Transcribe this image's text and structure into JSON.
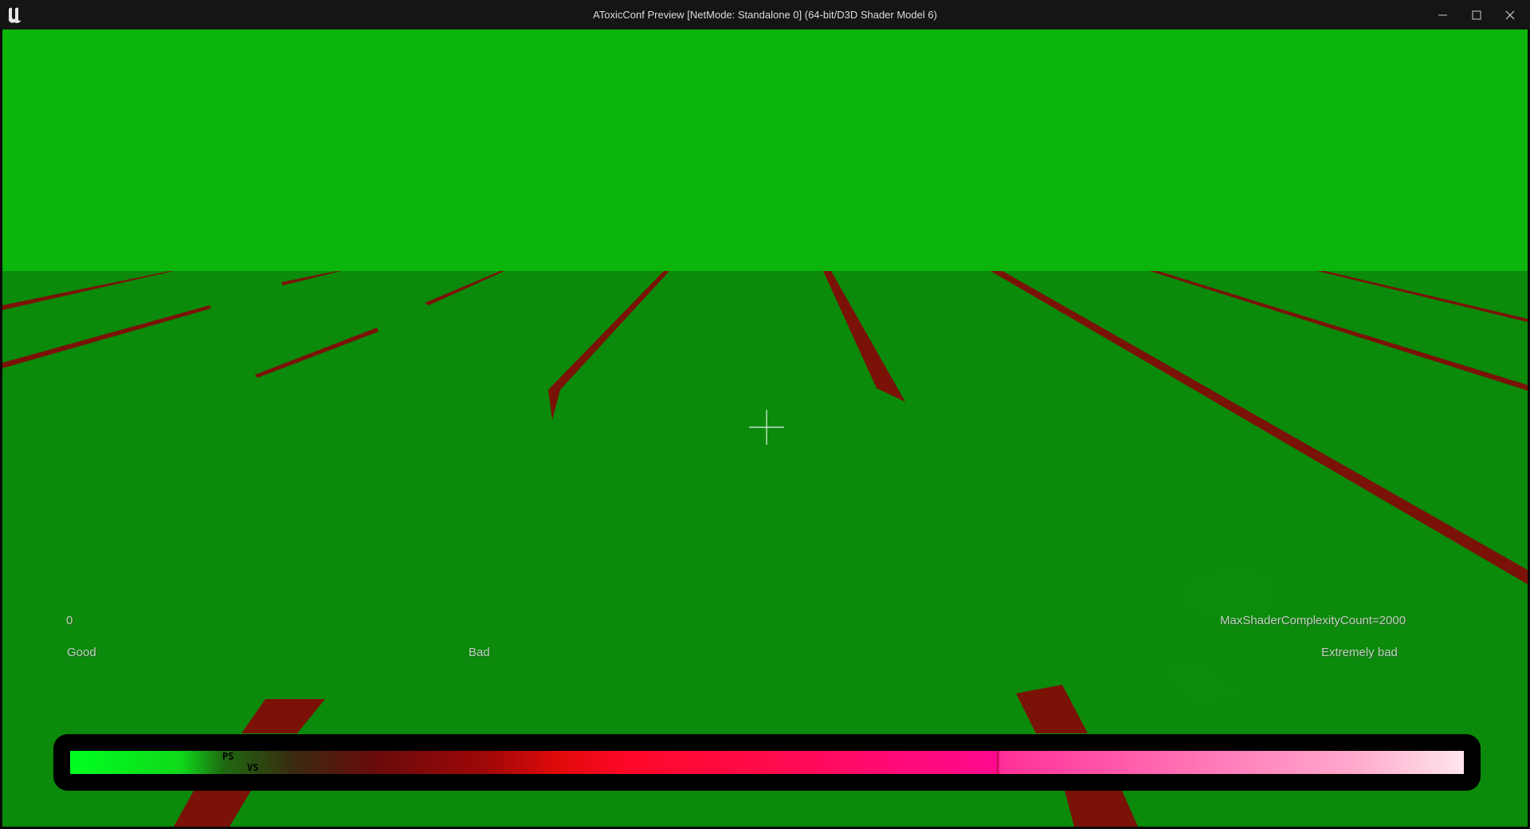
{
  "window": {
    "title": "AToxicConf Preview [NetMode: Standalone 0]  (64-bit/D3D Shader Model 6)",
    "controls": [
      "minimize",
      "maximize",
      "close"
    ]
  },
  "hud": {
    "min_value": "0",
    "max_label": "MaxShaderComplexityCount=2000",
    "legend": {
      "good": "Good",
      "bad": "Bad",
      "extremely_bad": "Extremely bad"
    },
    "markers": {
      "ps": "PS",
      "vs": "VS"
    }
  },
  "icons": {
    "logo": "unreal-engine-logo",
    "crosshair": "crosshair-icon"
  },
  "colors": {
    "sky": "#0bb50b",
    "ground": "#0b8a0b",
    "stripe": "#7a1208",
    "titlebar": "#151515"
  }
}
